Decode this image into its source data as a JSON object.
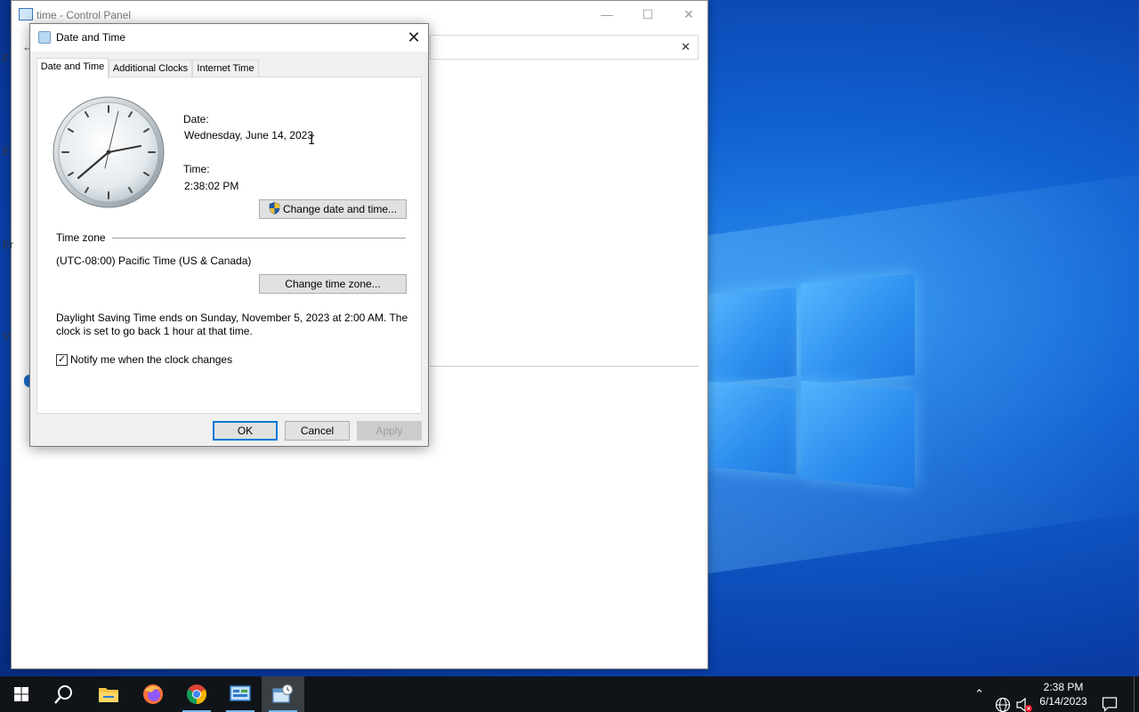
{
  "control_panel": {
    "title": "time - Control Panel",
    "edge_letters": [
      "F",
      "E",
      "Er",
      "V"
    ]
  },
  "dialog": {
    "title": "Date and Time",
    "tabs": [
      {
        "label": "Date and Time",
        "active": true
      },
      {
        "label": "Additional Clocks",
        "active": false
      },
      {
        "label": "Internet Time",
        "active": false
      }
    ],
    "date_label": "Date:",
    "date_value": "Wednesday, June 14, 2023",
    "time_label": "Time:",
    "time_value": "2:38:02 PM",
    "change_datetime_button": "Change date and time...",
    "timezone_header": "Time zone",
    "timezone_value": "(UTC-08:00) Pacific Time (US & Canada)",
    "change_timezone_button": "Change time zone...",
    "dst_text_line1": "Daylight Saving Time ends on Sunday, November 5, 2023 at 2:00 AM. The",
    "dst_text_line2": "clock is set to go back 1 hour at that time.",
    "notify_checkbox_label": "Notify me when the clock changes",
    "notify_checked": true,
    "ok_button": "OK",
    "cancel_button": "Cancel",
    "apply_button": "Apply"
  },
  "taskbar": {
    "items": [
      "start-icon",
      "search-icon",
      "file-explorer-icon",
      "firefox-icon",
      "chrome-icon",
      "control-panel-icon",
      "date-time-icon"
    ],
    "tray_time": "2:38 PM",
    "tray_date": "6/14/2023"
  },
  "colors": {
    "accent": "#0078d7",
    "taskbar": "#101418",
    "desktop": "#1060d0"
  }
}
